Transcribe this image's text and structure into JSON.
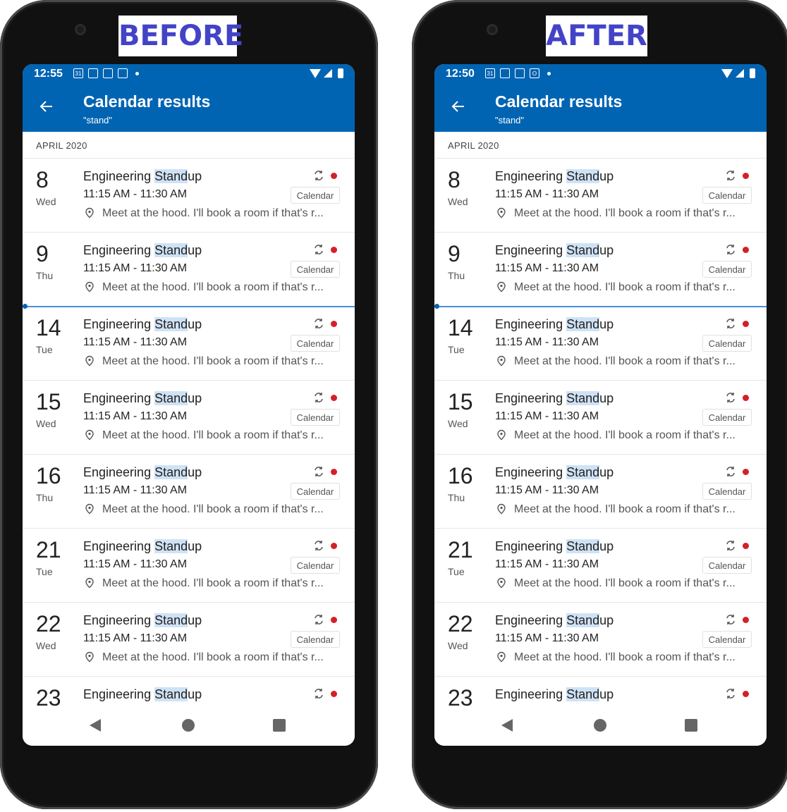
{
  "labels": {
    "before": "BEFORE",
    "after": "AFTER"
  },
  "phones": [
    {
      "id": "before",
      "time": "12:55",
      "status_icons": [
        "31",
        "msg",
        "msg",
        "mail"
      ]
    },
    {
      "id": "after",
      "time": "12:50",
      "status_icons": [
        "31",
        "msg",
        "msg",
        "O"
      ]
    }
  ],
  "header": {
    "title": "Calendar results",
    "query": "\"stand\""
  },
  "month": "APRIL 2020",
  "event": {
    "title_prefix": "Engineering ",
    "title_match": "Stand",
    "title_suffix": "up",
    "time": "11:15 AM - 11:30 AM",
    "location": "Meet at the hood. I'll book a room if that's r...",
    "calendar_label": "Calendar",
    "dot_color": "#d32027"
  },
  "days": [
    {
      "num": "8",
      "name": "Wed"
    },
    {
      "num": "9",
      "name": "Thu"
    },
    {
      "num": "14",
      "name": "Tue"
    },
    {
      "num": "15",
      "name": "Wed"
    },
    {
      "num": "16",
      "name": "Thu"
    },
    {
      "num": "21",
      "name": "Tue"
    },
    {
      "num": "22",
      "name": "Wed"
    },
    {
      "num": "23",
      "name": ""
    }
  ],
  "colors": {
    "appbar": "#0164b3",
    "highlight": "#cfe2f5",
    "label_text": "#4343c8"
  }
}
